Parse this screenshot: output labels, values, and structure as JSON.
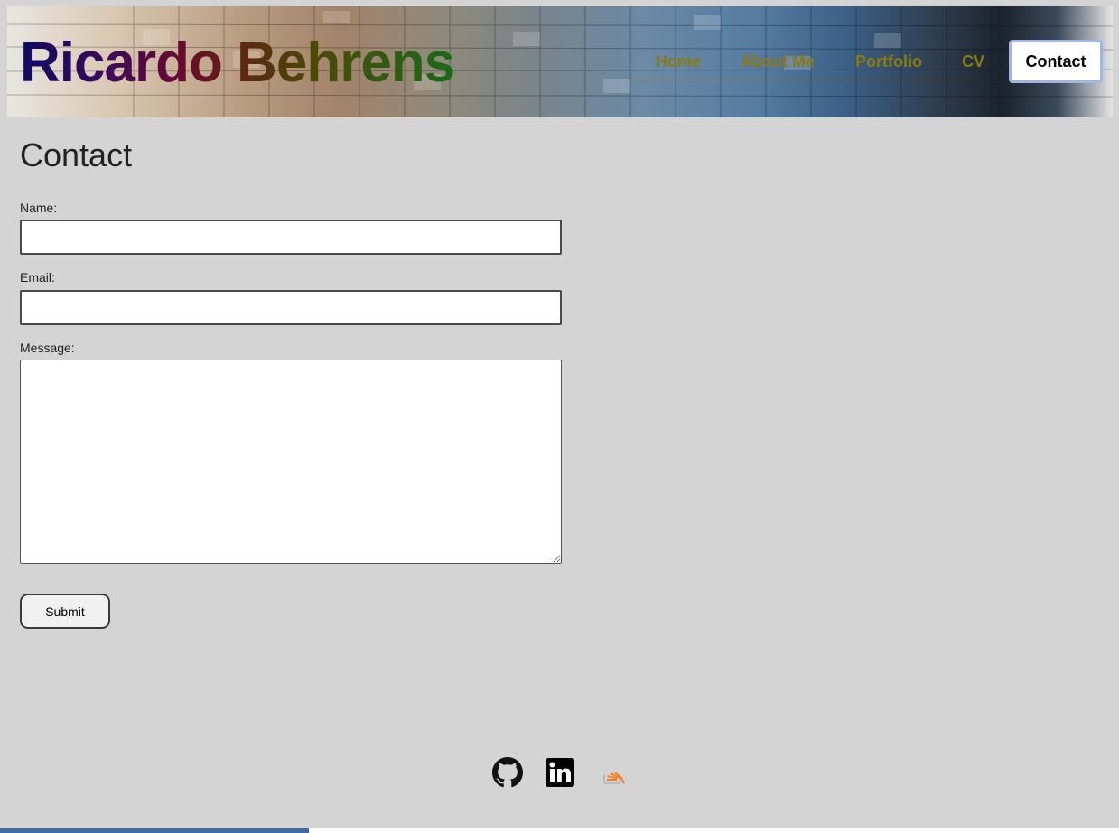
{
  "site": {
    "logo_text": "Ricardo Behrens"
  },
  "nav": {
    "items": [
      {
        "label": "Home",
        "active": false
      },
      {
        "label": "About Me",
        "active": false
      },
      {
        "label": "Portfolio",
        "active": false
      },
      {
        "label": "CV",
        "active": false
      },
      {
        "label": "Contact",
        "active": true
      }
    ]
  },
  "main": {
    "title": "Contact",
    "form": {
      "name_label": "Name:",
      "name_value": "",
      "email_label": "Email:",
      "email_value": "",
      "message_label": "Message:",
      "message_value": "",
      "submit_label": "Submit"
    }
  },
  "footer": {
    "social_icons": [
      "github-icon",
      "linkedin-icon",
      "stackoverflow-icon"
    ]
  },
  "colors": {
    "background": "#d4d4d4",
    "nav_text": "#8a7a10",
    "active_nav_border": "#9fb6e6",
    "progress_bar": "#3e6aa8"
  },
  "scroll_progress": 0.276
}
